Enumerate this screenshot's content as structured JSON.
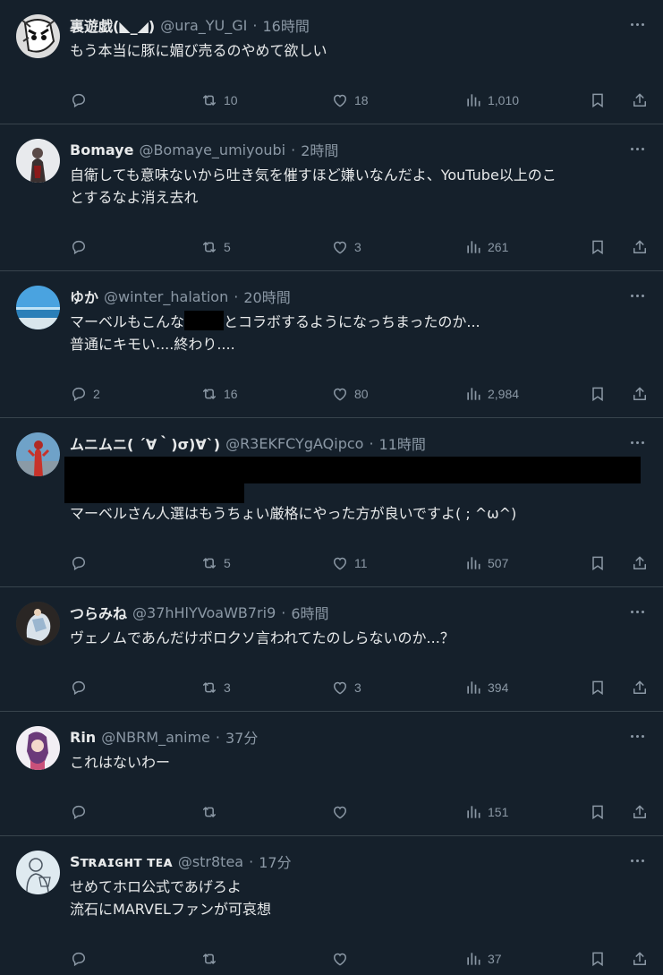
{
  "colors": {
    "background": "#15202b",
    "text": "#e7e9ea",
    "muted": "#8b98a5",
    "divider": "#38444d"
  },
  "tweets": [
    {
      "name": "裏遊戯(◣_◢)",
      "handle": "@ura_YU_GI",
      "dot": "·",
      "time": "16時間",
      "lines": [
        "もう本当に豚に媚び売るのやめて欲しい"
      ],
      "reply_count": "",
      "retweet_count": "10",
      "like_count": "18",
      "view_count": "1,010"
    },
    {
      "name": "Bomaye",
      "handle": "@Bomaye_umiyoubi",
      "dot": "·",
      "time": "2時間",
      "lines": [
        "自衛しても意味ないから吐き気を催すほど嫌いなんだよ、YouTube以上のこ",
        "とするなよ消え去れ"
      ],
      "reply_count": "",
      "retweet_count": "5",
      "like_count": "3",
      "view_count": "261"
    },
    {
      "name": "ゆか",
      "handle": "@winter_halation",
      "dot": "·",
      "time": "20時間",
      "line1_before": "マーベルもこんな",
      "line1_after": "とコラボするようになっちまったのか...",
      "line2": "普通にキモい....終わり....",
      "reply_count": "2",
      "retweet_count": "16",
      "like_count": "80",
      "view_count": "2,984"
    },
    {
      "name": "ムニムニ( ´∀｀)σ)∀`)",
      "handle": "@R3EKFCYgAQipco",
      "dot": "·",
      "time": "11時間",
      "lines": [
        "マーベルさん人選はもうちょい厳格にやった方が良いですよ( ; ^ω^)"
      ],
      "reply_count": "",
      "retweet_count": "5",
      "like_count": "11",
      "view_count": "507"
    },
    {
      "name": "つらみね",
      "handle": "@37hHlYVoaWB7ri9",
      "dot": "·",
      "time": "6時間",
      "lines": [
        "ヴェノムであんだけボロクソ言われてたのしらないのか...？"
      ],
      "reply_count": "",
      "retweet_count": "3",
      "like_count": "3",
      "view_count": "394"
    },
    {
      "name": "Rin",
      "handle": "@NBRM_anime",
      "dot": "·",
      "time": "37分",
      "lines": [
        "これはないわー"
      ],
      "reply_count": "",
      "retweet_count": "",
      "like_count": "",
      "view_count": "151"
    },
    {
      "name": "Sᴛʀᴀɪɢʜᴛ ᴛᴇᴀ",
      "handle": "@str8tea",
      "dot": "·",
      "time": "17分",
      "lines": [
        "せめてホロ公式であげろよ",
        "流石にMARVELファンが可哀想"
      ],
      "reply_count": "",
      "retweet_count": "",
      "like_count": "",
      "view_count": "37"
    }
  ],
  "icons": {
    "reply": "reply-icon",
    "retweet": "retweet-icon",
    "like": "heart-icon",
    "views": "views-chart-icon",
    "bookmark": "bookmark-icon",
    "share": "share-icon",
    "more": "more-dots-icon"
  }
}
